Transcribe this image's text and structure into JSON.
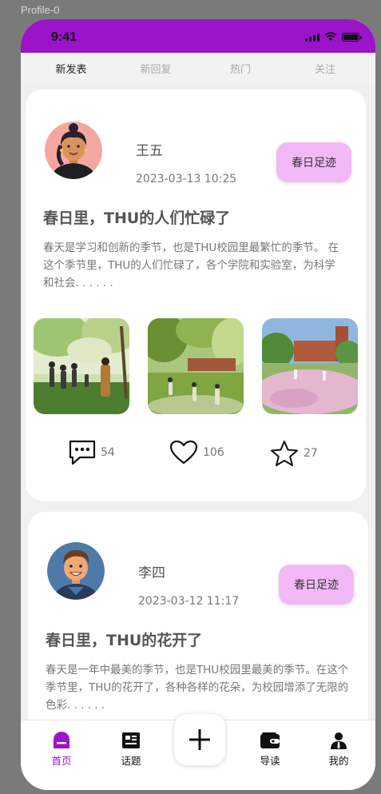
{
  "frame": {
    "label": "Profile-0"
  },
  "status_bar": {
    "time": "9:41",
    "color": "#9b14c9"
  },
  "tabs": [
    {
      "label": "新发表",
      "active": true
    },
    {
      "label": "新回复",
      "active": false
    },
    {
      "label": "热门",
      "active": false
    },
    {
      "label": "关注",
      "active": false
    }
  ],
  "posts": [
    {
      "author": "王五",
      "time": "2023-03-13 10:25",
      "topic": "春日足迹",
      "title": "春日里，THU的人们忙碌了",
      "body": "春天是学习和创新的季节，也是THU校园里最繁忙的季节。 在这个季节里，THU的人们忙碌了，各个学院和实验室，为科学和社会. . . . . .",
      "images": [
        "cherry-blossom-crowd-image",
        "park-people-image",
        "campus-flowers-image"
      ],
      "comments": "54",
      "likes": "106",
      "stars": "27"
    },
    {
      "author": "李四",
      "time": "2023-03-12 11:17",
      "topic": "春日足迹",
      "title": "春日里，THU的花开了",
      "body": "春天是一年中最美的季节，也是THU校园里最美的季节。在这个季节里，THU的花开了，各种各样的花朵，为校园增添了无限的色彩. . . . . ."
    }
  ],
  "bottom_nav": [
    {
      "label": "首页",
      "icon": "home-icon",
      "active": true
    },
    {
      "label": "话题",
      "icon": "topic-icon",
      "active": false
    },
    {
      "label": "导读",
      "icon": "wallet-icon",
      "active": false
    },
    {
      "label": "我的",
      "icon": "person-icon",
      "active": false
    }
  ],
  "colors": {
    "accent": "#9b14c9",
    "chip": "#f3b9f7"
  }
}
